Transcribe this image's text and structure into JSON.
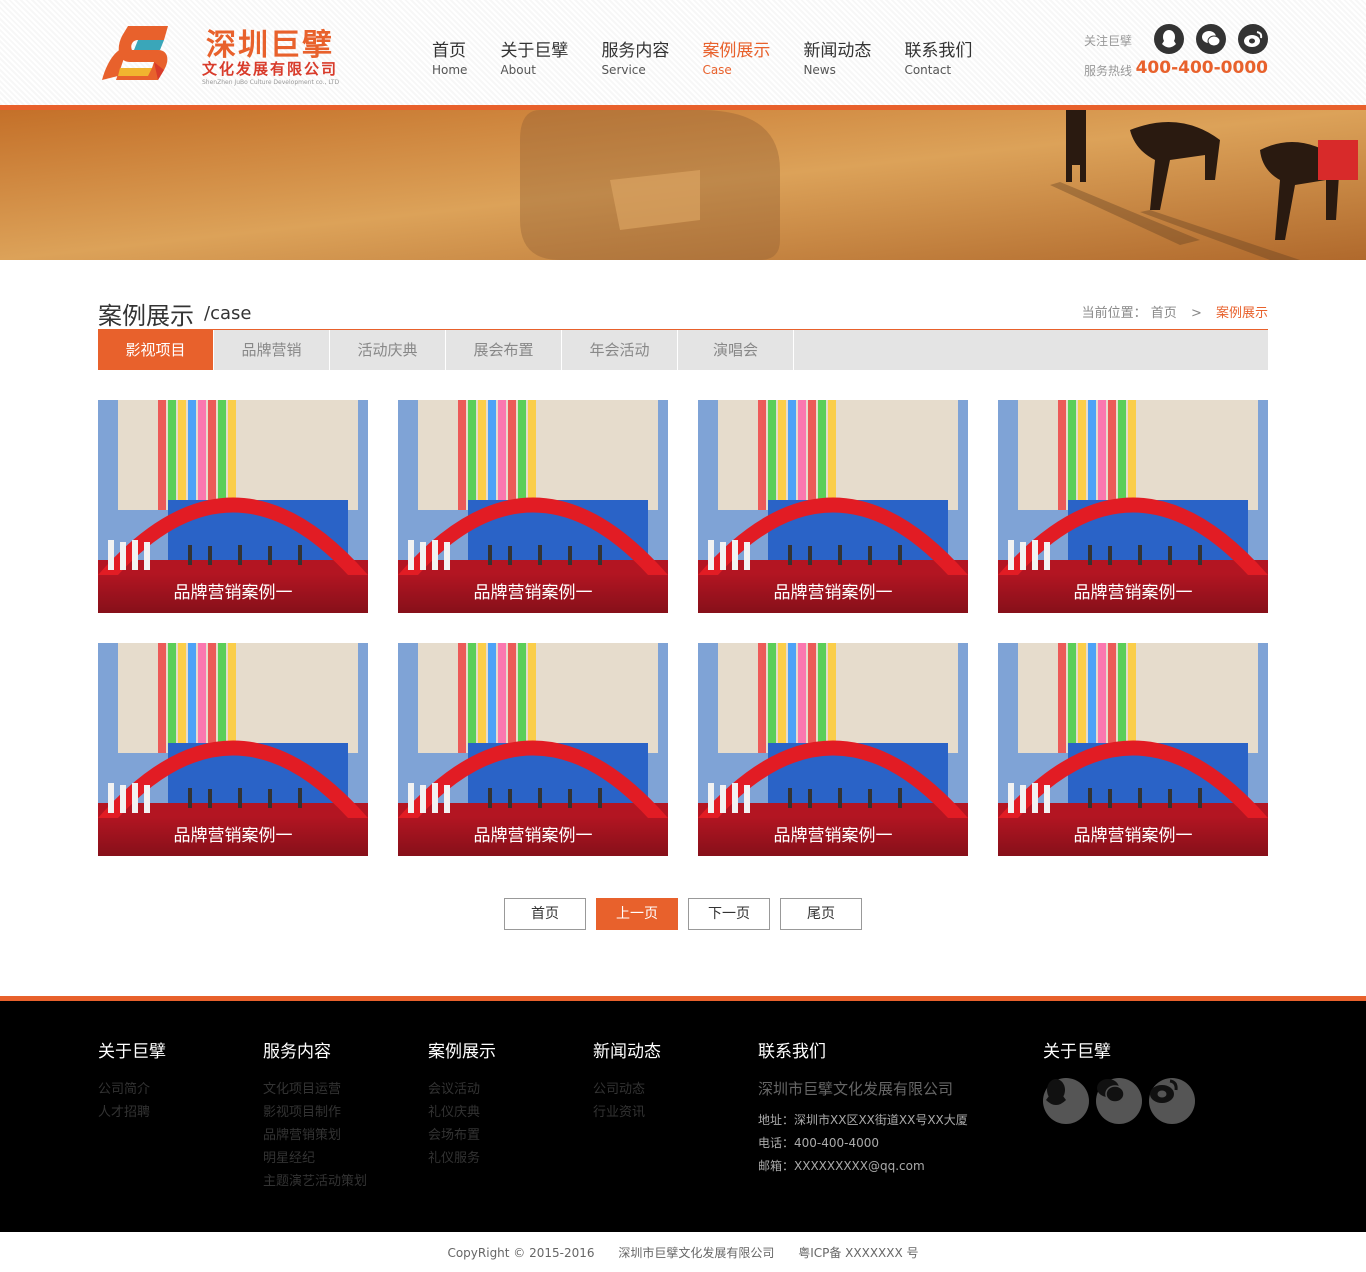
{
  "header": {
    "logo_title": "深圳巨擘",
    "logo_subtitle": "文化发展有限公司",
    "logo_en": "ShenZhen JuBo Culture Development co., LTD",
    "nav": [
      {
        "cn": "首页",
        "en": "Home"
      },
      {
        "cn": "关于巨擘",
        "en": "About"
      },
      {
        "cn": "服务内容",
        "en": "Service"
      },
      {
        "cn": "案例展示",
        "en": "Case"
      },
      {
        "cn": "新闻动态",
        "en": "News"
      },
      {
        "cn": "联系我们",
        "en": "Contact"
      }
    ],
    "active_nav": 3,
    "follow_label": "关注巨擘",
    "hotline_label": "服务热线",
    "hotline": "400-400-0000",
    "social_icons": [
      "qq-icon",
      "wechat-icon",
      "weibo-icon"
    ]
  },
  "page": {
    "title": "案例展示",
    "subtitle": "/case",
    "breadcrumb_label": "当前位置：",
    "breadcrumb_home": "首页",
    "breadcrumb_sep": ">",
    "breadcrumb_current": "案例展示"
  },
  "tabs": [
    "影视项目",
    "品牌营销",
    "活动庆典",
    "展会布置",
    "年会活动",
    "演唱会"
  ],
  "active_tab": 0,
  "cases": [
    {
      "caption": "品牌营销案例一"
    },
    {
      "caption": "品牌营销案例一"
    },
    {
      "caption": "品牌营销案例一"
    },
    {
      "caption": "品牌营销案例一"
    },
    {
      "caption": "品牌营销案例一"
    },
    {
      "caption": "品牌营销案例一"
    },
    {
      "caption": "品牌营销案例一"
    },
    {
      "caption": "品牌营销案例一"
    }
  ],
  "pager": {
    "first": "首页",
    "prev": "上一页",
    "next": "下一页",
    "last": "尾页"
  },
  "footer": {
    "about": {
      "title": "关于巨擘",
      "links": [
        "公司简介",
        "人才招聘"
      ]
    },
    "service": {
      "title": "服务内容",
      "links": [
        "文化项目运营",
        "影视项目制作",
        "品牌营销策划",
        "明星经纪",
        "主题演艺活动策划"
      ]
    },
    "cases": {
      "title": "案例展示",
      "links": [
        "会议活动",
        "礼仪庆典",
        "会场布置",
        "礼仪服务"
      ]
    },
    "news": {
      "title": "新闻动态",
      "links": [
        "公司动态",
        "行业资讯"
      ]
    },
    "contact": {
      "title": "联系我们",
      "company": "深圳市巨擘文化发展有限公司",
      "address": "地址：深圳市XX区XX街道XX号XX大厦",
      "phone": "电话：400-400-4000",
      "email": "邮箱：XXXXXXXXX@qq.com"
    },
    "follow": {
      "title": "关于巨擘"
    }
  },
  "copyright": {
    "text": "CopyRight © 2015-2016",
    "company": "深圳市巨擘文化发展有限公司",
    "icp": "粤ICP备 XXXXXXX 号"
  },
  "colors": {
    "accent": "#e8612c",
    "footer_bg": "#000000"
  }
}
